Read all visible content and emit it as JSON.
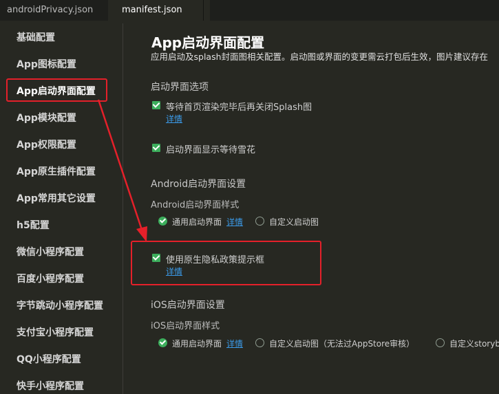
{
  "tabs": [
    {
      "label": "androidPrivacy.json"
    },
    {
      "label": "manifest.json"
    }
  ],
  "sidebar": {
    "items": [
      {
        "label": "基础配置"
      },
      {
        "label": "App图标配置"
      },
      {
        "label": "App启动界面配置"
      },
      {
        "label": "App模块配置"
      },
      {
        "label": "App权限配置"
      },
      {
        "label": "App原生插件配置"
      },
      {
        "label": "App常用其它设置"
      },
      {
        "label": "h5配置"
      },
      {
        "label": "微信小程序配置"
      },
      {
        "label": "百度小程序配置"
      },
      {
        "label": "字节跳动小程序配置"
      },
      {
        "label": "支付宝小程序配置"
      },
      {
        "label": "QQ小程序配置"
      },
      {
        "label": "快手小程序配置"
      }
    ]
  },
  "main": {
    "title": "App启动界面配置",
    "description": "应用启动及splash封面图相关配置。启动图或界面的变更需云打包后生效，图片建议存在",
    "startup_options": {
      "heading": "启动界面选项",
      "wait_first_page": "等待首页渲染完毕后再关闭Splash图",
      "wait_first_page_link": "详情",
      "show_snowflake": "启动界面显示等待雪花"
    },
    "android": {
      "heading": "Android启动界面设置",
      "style_label": "Android启动界面样式",
      "option_common": "通用启动界面",
      "option_common_link": "详情",
      "option_custom": "自定义启动图",
      "privacy_prompt": "使用原生隐私政策提示框",
      "privacy_link": "详情"
    },
    "ios": {
      "heading": "iOS启动界面设置",
      "style_label": "iOS启动界面样式",
      "option_common": "通用启动界面",
      "option_common_link": "详情",
      "option_custom": "自定义启动图（无法过AppStore审核）",
      "option_storyboard": "自定义storyb"
    }
  },
  "colors": {
    "highlight": "#e5202a",
    "accent": "#3cae5c",
    "link": "#3b9bea"
  }
}
